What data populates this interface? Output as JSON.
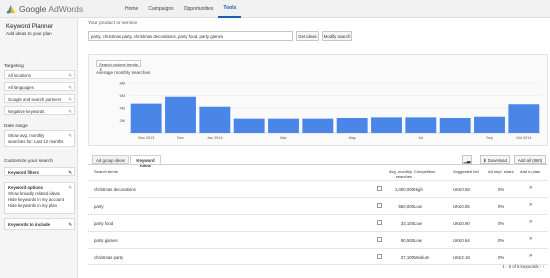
{
  "app": {
    "logo_text_bold": "Google",
    "logo_text_rest": " AdWords"
  },
  "nav": [
    "Home",
    "Campaigns",
    "Opportunities",
    "Tools"
  ],
  "left": {
    "title": "Keyword Planner",
    "subtitle": "Add ideas to your plan",
    "targeting_label": "Targeting",
    "targeting": [
      "All locations",
      "All languages",
      "Google and search partners",
      "Negative keywords"
    ],
    "date_label": "Date range",
    "date_value_line1": "Show avg. monthly",
    "date_value_line2": "searches for: Last 12 months",
    "customize_label": "Customize your search",
    "keyword_filters": "Keyword filters",
    "keyword_options_title": "Keyword options",
    "keyword_options": [
      "Show broadly related ideas",
      "Hide keywords in my account",
      "Hide keywords in my plan"
    ],
    "keywords_include": "Keywords to include"
  },
  "search": {
    "label": "Your product or service",
    "value": "party, christmas party, christmas decorations, party food, party games",
    "get_ideas": "Get ideas",
    "modify": "Modify search"
  },
  "chart": {
    "dropdown": "Search volume trends",
    "title": "Average monthly searches"
  },
  "chart_data": {
    "type": "bar",
    "title": "Average monthly searches",
    "y_ticks": [
      "8M",
      "6M",
      "4M",
      "2M"
    ],
    "ylim": [
      0,
      8000000
    ],
    "categories": [
      "Nov 2013",
      "Dec",
      "Jan 2014",
      "Feb",
      "Mar",
      "Apr",
      "May",
      "Jun",
      "Jul",
      "Aug",
      "Sep",
      "Oct 2014"
    ],
    "x_labels": [
      "Nov 2013",
      "Dec",
      "Jan 2014",
      "",
      "Mar",
      "",
      "May",
      "",
      "Jul",
      "",
      "Sep",
      "Oct 2014"
    ],
    "values": [
      4700000,
      5800000,
      4200000,
      2300000,
      2300000,
      2300000,
      2400000,
      2500000,
      2500000,
      2400000,
      2600000,
      4600000
    ],
    "bar_color": "#4a86e8"
  },
  "tabs": {
    "ad_group": "Ad group ideas",
    "keyword": "Keyword ideas"
  },
  "tools": {
    "download": "Download",
    "add_all": "Add all (860)"
  },
  "table": {
    "headers": {
      "term": "Search terms",
      "avg": "Avg. monthly searches",
      "competition": "Competition",
      "bid": "Suggested bid",
      "share": "Ad impr. share",
      "add": "Add to plan"
    },
    "rows": [
      {
        "term": "christmas decorations",
        "avg": "1,000,000",
        "competition": "High",
        "bid": "UK£0.58",
        "share": "0%"
      },
      {
        "term": "party",
        "avg": "550,000",
        "competition": "Low",
        "bid": "UK£0.55",
        "share": "0%"
      },
      {
        "term": "party food",
        "avg": "33,100",
        "competition": "Low",
        "bid": "UK£0.90",
        "share": "0%"
      },
      {
        "term": "party games",
        "avg": "90,500",
        "competition": "Low",
        "bid": "UK£0.64",
        "share": "0%"
      },
      {
        "term": "christmas party",
        "avg": "27,100",
        "competition": "Medium",
        "bid": "UK£2.18",
        "share": "0%"
      }
    ]
  },
  "pager": "1 - 5 of 5 keywords"
}
